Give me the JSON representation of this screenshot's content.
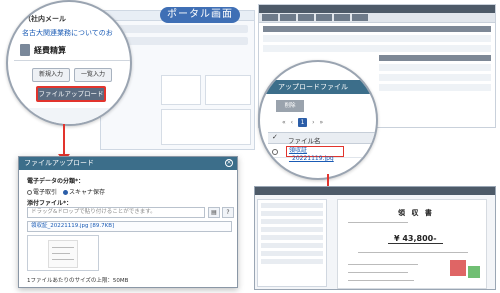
{
  "portal": {
    "label": "ポータル画面",
    "mail_label": "（社内メール",
    "link_text": "名古大関連業務についてのお"
  },
  "magnifier": {
    "title": "経費精算",
    "new_button": "新規入力",
    "list_button": "一覧入力",
    "upload_button": "ファイルアップロード"
  },
  "dialog": {
    "title": "ファイルアップロード",
    "type_label": "電子データの分類*：",
    "radio_electronic": "電子取引",
    "radio_scan": "スキャナ保存",
    "file_label": "添付ファイル*：",
    "drop_placeholder": "ドラッグ&ドロップで貼り付けることができます。",
    "file_name": "領収証_20221119.jpg [89.7KB]",
    "note": "1ファイルあたりのサイズの上限：50MB"
  },
  "file_list": {
    "title": "アップロードファイル",
    "gray_button": "削除",
    "page": "1",
    "column_header": "ファイル名",
    "file_name": "領収証_20221119.jpg"
  },
  "receipt": {
    "title": "領 収 書",
    "amount": "¥ 43,800-"
  },
  "colors": {
    "accent_blue": "#3c6e8a",
    "highlight_red": "#e2342d",
    "link_blue": "#1a5bb5"
  }
}
